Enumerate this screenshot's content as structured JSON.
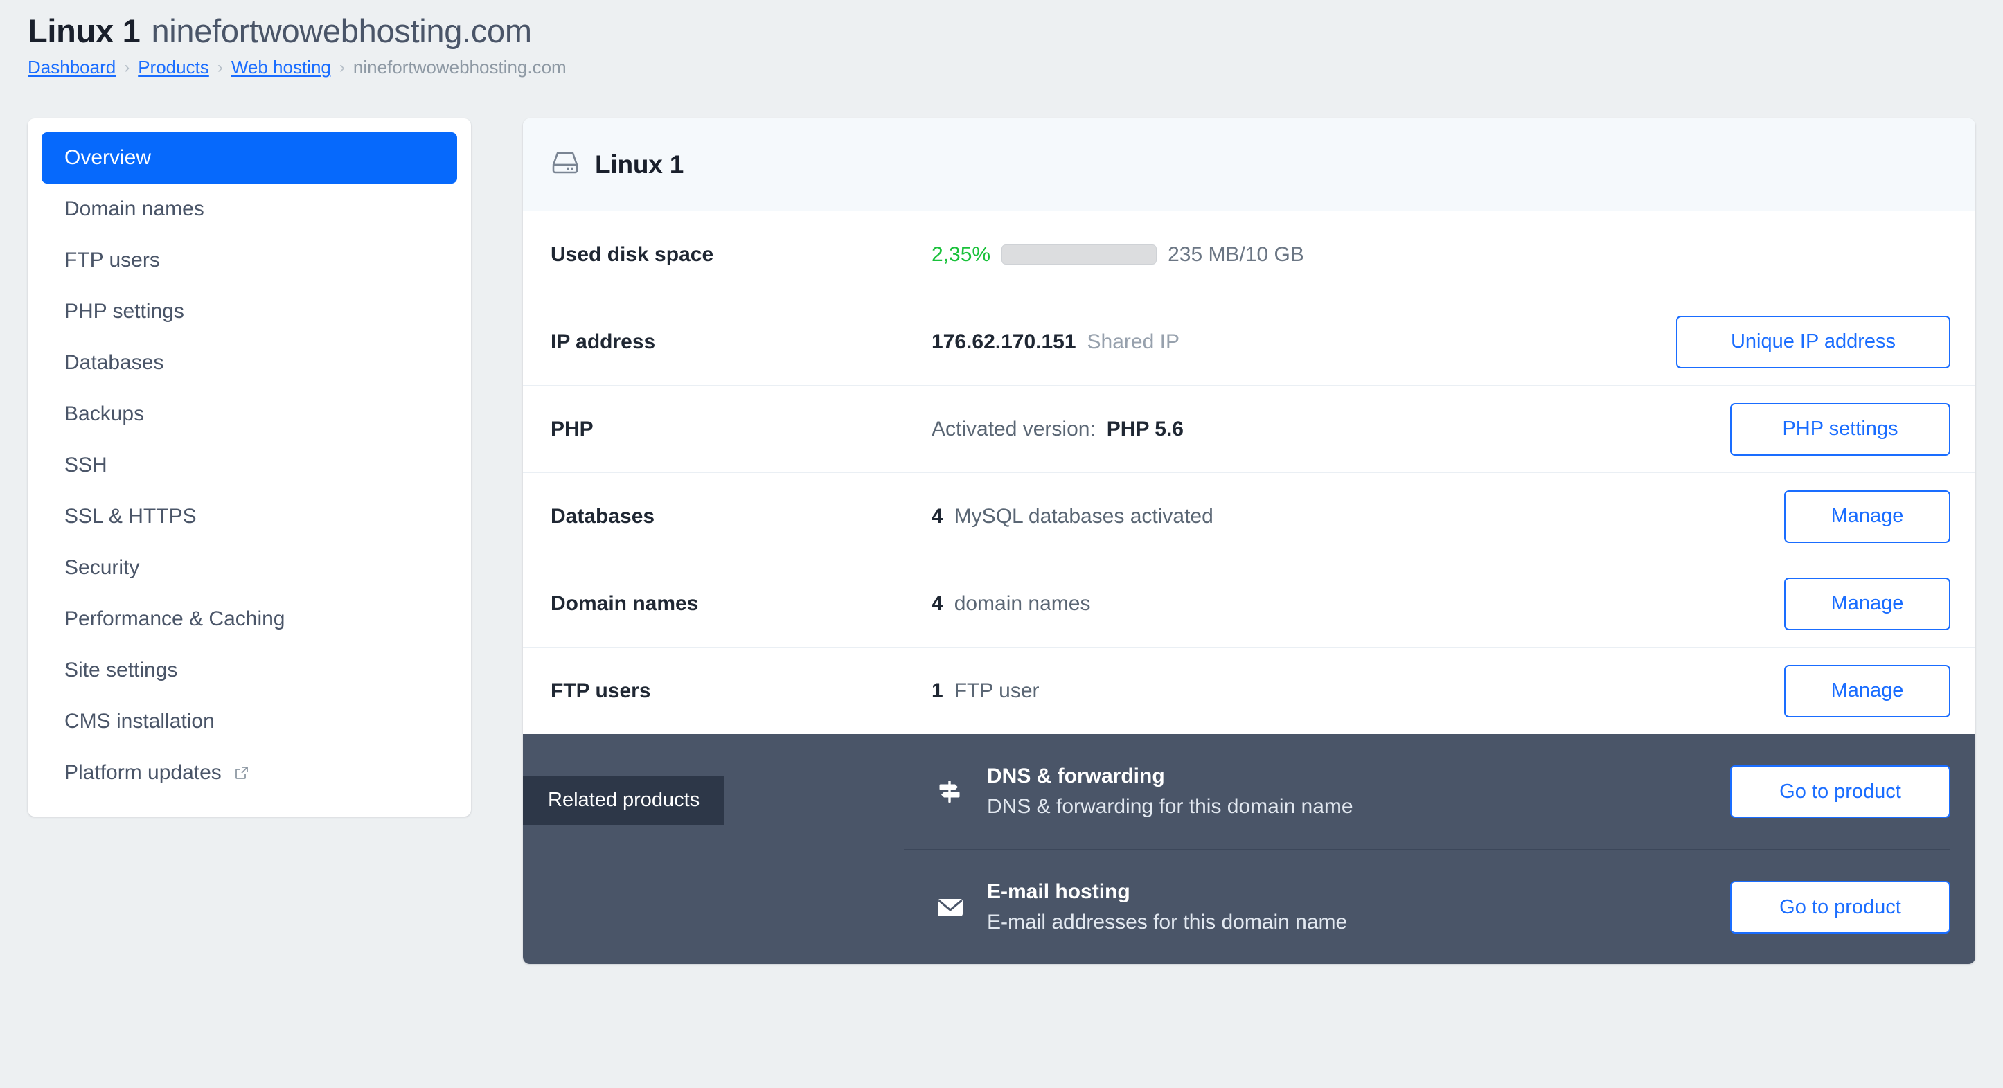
{
  "header": {
    "title_main": "Linux 1",
    "title_domain": "ninefortwowebhosting.com",
    "breadcrumb": [
      {
        "label": "Dashboard",
        "link": true
      },
      {
        "label": "Products",
        "link": true
      },
      {
        "label": "Web hosting",
        "link": true
      },
      {
        "label": "ninefortwowebhosting.com",
        "link": false
      }
    ],
    "breadcrumb_separator": "›"
  },
  "sidebar": {
    "items": [
      {
        "label": "Overview",
        "active": true,
        "external": false
      },
      {
        "label": "Domain names",
        "active": false,
        "external": false
      },
      {
        "label": "FTP users",
        "active": false,
        "external": false
      },
      {
        "label": "PHP settings",
        "active": false,
        "external": false
      },
      {
        "label": "Databases",
        "active": false,
        "external": false
      },
      {
        "label": "Backups",
        "active": false,
        "external": false
      },
      {
        "label": "SSH",
        "active": false,
        "external": false
      },
      {
        "label": "SSL & HTTPS",
        "active": false,
        "external": false
      },
      {
        "label": "Security",
        "active": false,
        "external": false
      },
      {
        "label": "Performance & Caching",
        "active": false,
        "external": false
      },
      {
        "label": "Site settings",
        "active": false,
        "external": false
      },
      {
        "label": "CMS installation",
        "active": false,
        "external": false
      },
      {
        "label": "Platform updates",
        "active": false,
        "external": true
      }
    ]
  },
  "card": {
    "icon": "hard-drive-icon",
    "title": "Linux 1",
    "rows": {
      "disk": {
        "label": "Used disk space",
        "percent_text": "2,35%",
        "percent_value": 2.35,
        "usage_text": "235 MB/10 GB",
        "percent_color": "#19c13a"
      },
      "ip": {
        "label": "IP address",
        "value": "176.62.170.151",
        "note": "Shared IP",
        "button": "Unique IP address"
      },
      "php": {
        "label": "PHP",
        "value_prefix": "Activated version:",
        "value_strong": "PHP 5.6",
        "button": "PHP settings"
      },
      "databases": {
        "label": "Databases",
        "count": "4",
        "value_text": "MySQL databases activated",
        "button": "Manage"
      },
      "domains": {
        "label": "Domain names",
        "count": "4",
        "value_text": "domain names",
        "button": "Manage"
      },
      "ftp": {
        "label": "FTP users",
        "count": "1",
        "value_text": "FTP user",
        "button": "Manage"
      }
    }
  },
  "related": {
    "badge": "Related products",
    "items": [
      {
        "icon": "signpost-icon",
        "title": "DNS & forwarding",
        "subtitle": "DNS & forwarding for this domain name",
        "button": "Go to product"
      },
      {
        "icon": "envelope-icon",
        "title": "E-mail hosting",
        "subtitle": "E-mail addresses for this domain name",
        "button": "Go to product"
      }
    ]
  },
  "colors": {
    "accent_blue": "#0669fc",
    "link_blue": "#1a6dff",
    "success_green": "#19c13a",
    "panel_slate": "#4a5568",
    "badge_slate": "#2d3748",
    "page_bg": "#edf0f2"
  }
}
